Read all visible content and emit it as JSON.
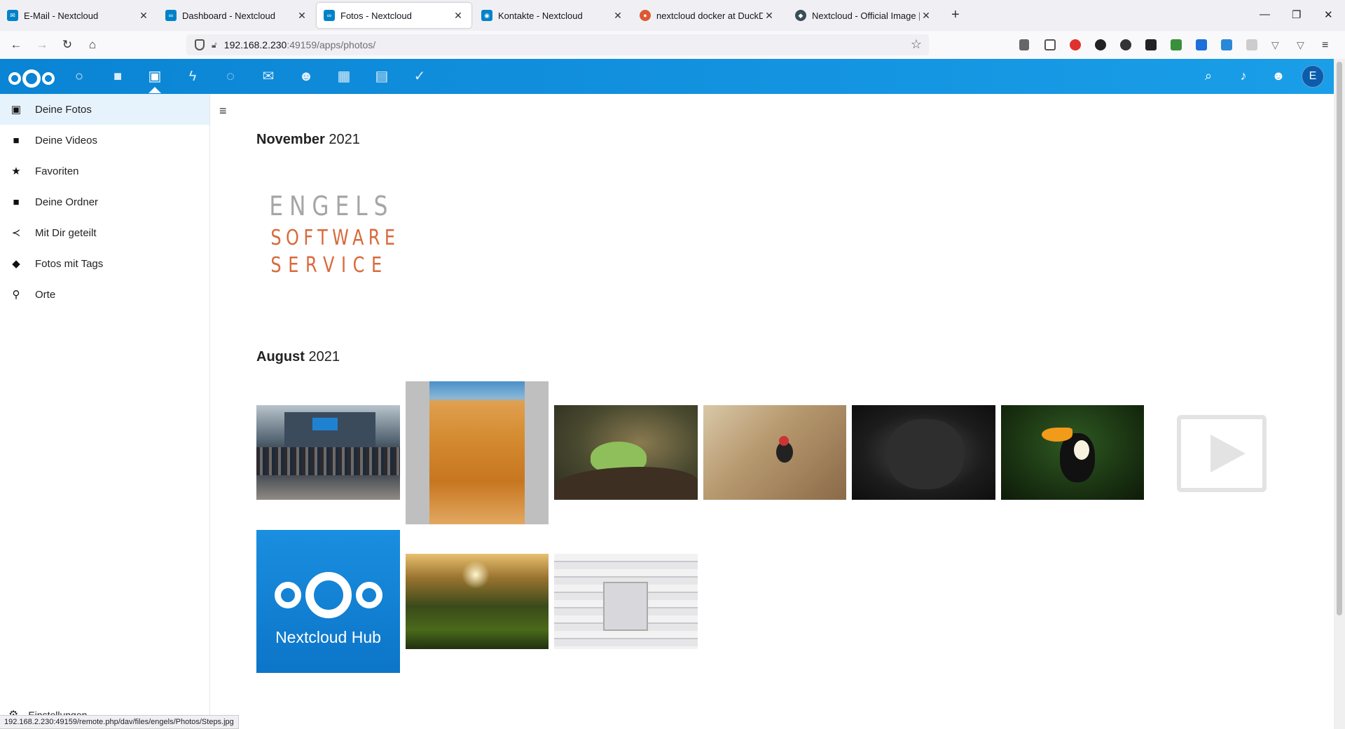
{
  "browser": {
    "tabs": [
      {
        "title": "E-Mail - Nextcloud",
        "icon": "mail-icon"
      },
      {
        "title": "Dashboard - Nextcloud",
        "icon": "nextcloud-icon"
      },
      {
        "title": "Fotos - Nextcloud",
        "icon": "nextcloud-icon",
        "active": true
      },
      {
        "title": "Kontakte - Nextcloud",
        "icon": "contacts-icon"
      },
      {
        "title": "nextcloud docker at DuckDuckGo",
        "icon": "duckduckgo-icon"
      },
      {
        "title": "Nextcloud - Official Image | Docker Hub",
        "icon": "docker-icon"
      }
    ],
    "url_host": "192.168.2.230",
    "url_rest": ":49159/apps/photos/"
  },
  "header": {
    "avatar_letter": "E",
    "accent": "#0082c9"
  },
  "sidebar": {
    "items": [
      {
        "label": "Deine Fotos",
        "icon": "image-icon"
      },
      {
        "label": "Deine Videos",
        "icon": "video-icon"
      },
      {
        "label": "Favoriten",
        "icon": "star-icon"
      },
      {
        "label": "Deine Ordner",
        "icon": "folder-icon"
      },
      {
        "label": "Mit Dir geteilt",
        "icon": "share-icon"
      },
      {
        "label": "Fotos mit Tags",
        "icon": "tag-icon"
      },
      {
        "label": "Orte",
        "icon": "location-pin-icon"
      }
    ],
    "settings_label": "Einstellungen"
  },
  "main": {
    "sections": [
      {
        "month": "November",
        "year": "2021"
      },
      {
        "month": "August",
        "year": "2021"
      }
    ],
    "engels_logo": {
      "line1": "ENGELS",
      "line2": "SOFTWARE",
      "line3": "SERVICE"
    },
    "nextcloud_hub_label": "Nextcloud Hub"
  },
  "statusbar": {
    "text": "192.168.2.230:49159/remote.php/dav/files/engels/Photos/Steps.jpg"
  }
}
